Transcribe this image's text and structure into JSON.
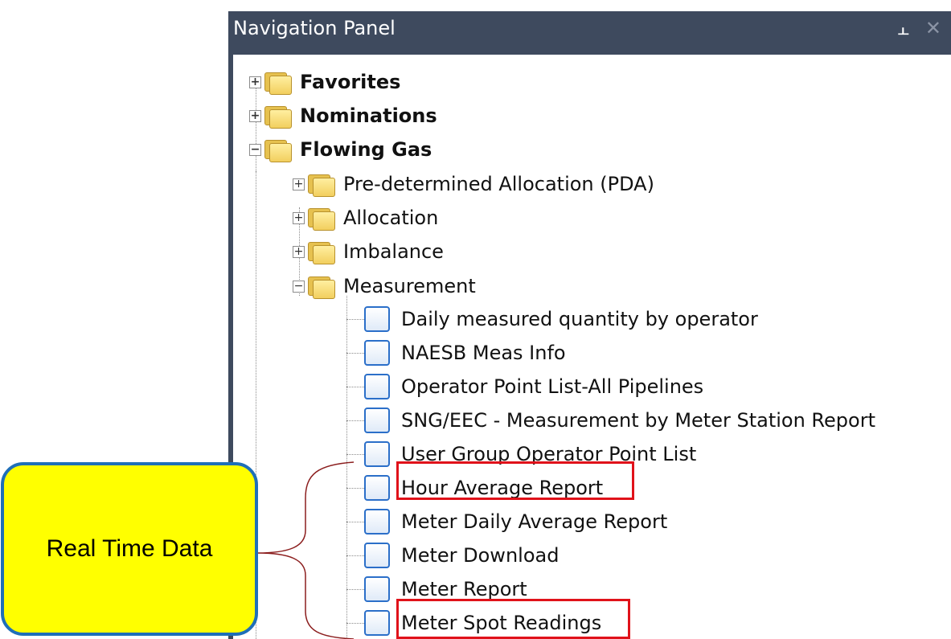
{
  "panel": {
    "title": "Navigation Panel",
    "pin_icon": "pin-icon",
    "close_icon": "close-icon"
  },
  "tree": {
    "top": [
      {
        "label": "Favorites",
        "state": "collapsed"
      },
      {
        "label": "Nominations",
        "state": "collapsed"
      },
      {
        "label": "Flowing Gas",
        "state": "expanded"
      }
    ],
    "flowing_gas_children": [
      {
        "label": "Pre-determined Allocation (PDA)",
        "state": "collapsed"
      },
      {
        "label": "Allocation",
        "state": "collapsed"
      },
      {
        "label": "Imbalance",
        "state": "collapsed"
      },
      {
        "label": "Measurement",
        "state": "expanded"
      }
    ],
    "measurement_items": [
      "Daily measured quantity by operator",
      "NAESB Meas Info",
      "Operator Point List-All Pipelines",
      "SNG/EEC - Measurement by Meter Station Report",
      "User Group Operator Point List",
      "Hour Average Report",
      "Meter Daily Average Report",
      "Meter Download",
      "Meter Report",
      "Meter Spot Readings"
    ],
    "highlighted": [
      "Hour Average Report",
      "Meter Spot Readings"
    ]
  },
  "callout": {
    "label": "Real Time Data",
    "fill_color": "#ffff00",
    "border_color": "#1f6fb8"
  },
  "colors": {
    "titlebar": "#3e4a5e",
    "highlight": "#e0121a"
  }
}
